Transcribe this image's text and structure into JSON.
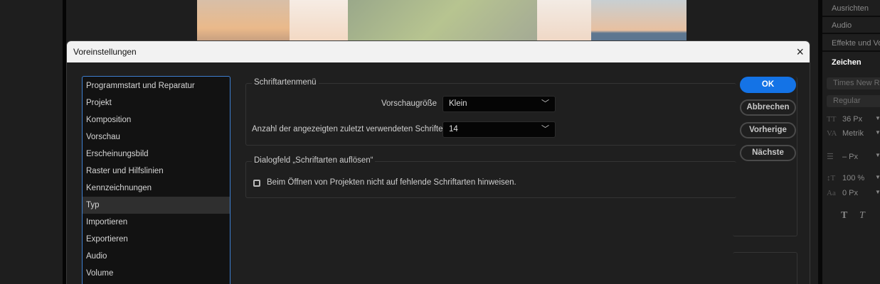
{
  "right_panel": {
    "tabs": [
      "Ausrichten",
      "Audio",
      "Effekte und Vorgaben",
      "Zeichen"
    ],
    "font_family": "Times New Roman",
    "font_style": "Regular",
    "font_size": "36 Px",
    "kerning": "Metrik",
    "leading": "– Px",
    "vertical_scale": "100 %",
    "baseline_shift": "0 Px",
    "style_buttons": [
      "T",
      "T"
    ]
  },
  "dialog": {
    "title": "Voreinstellungen",
    "close_icon": "×",
    "categories": [
      "Programmstart und Reparatur",
      "Projekt",
      "Komposition",
      "Vorschau",
      "Erscheinungsbild",
      "Raster und Hilfslinien",
      "Kennzeichnungen",
      "Typ",
      "Importieren",
      "Exportieren",
      "Audio",
      "Volume"
    ],
    "selected_category": "Typ",
    "section1": {
      "legend": "Schriftartenmenü",
      "preview_size_label": "Vorschaugröße",
      "preview_size_value": "Klein",
      "recent_count_label": "Anzahl der angezeigten zuletzt verwendeten Schriften",
      "recent_count_value": "14"
    },
    "section2": {
      "legend": "Dialogfeld „Schriftarten auflösen“",
      "checkbox_label": "Beim Öffnen von Projekten nicht auf fehlende Schriftarten hinweisen.",
      "checkbox_checked": false
    },
    "buttons": {
      "ok": "OK",
      "cancel": "Abbrechen",
      "previous": "Vorherige",
      "next": "Nächste"
    },
    "accent_color": "#1473e6"
  }
}
